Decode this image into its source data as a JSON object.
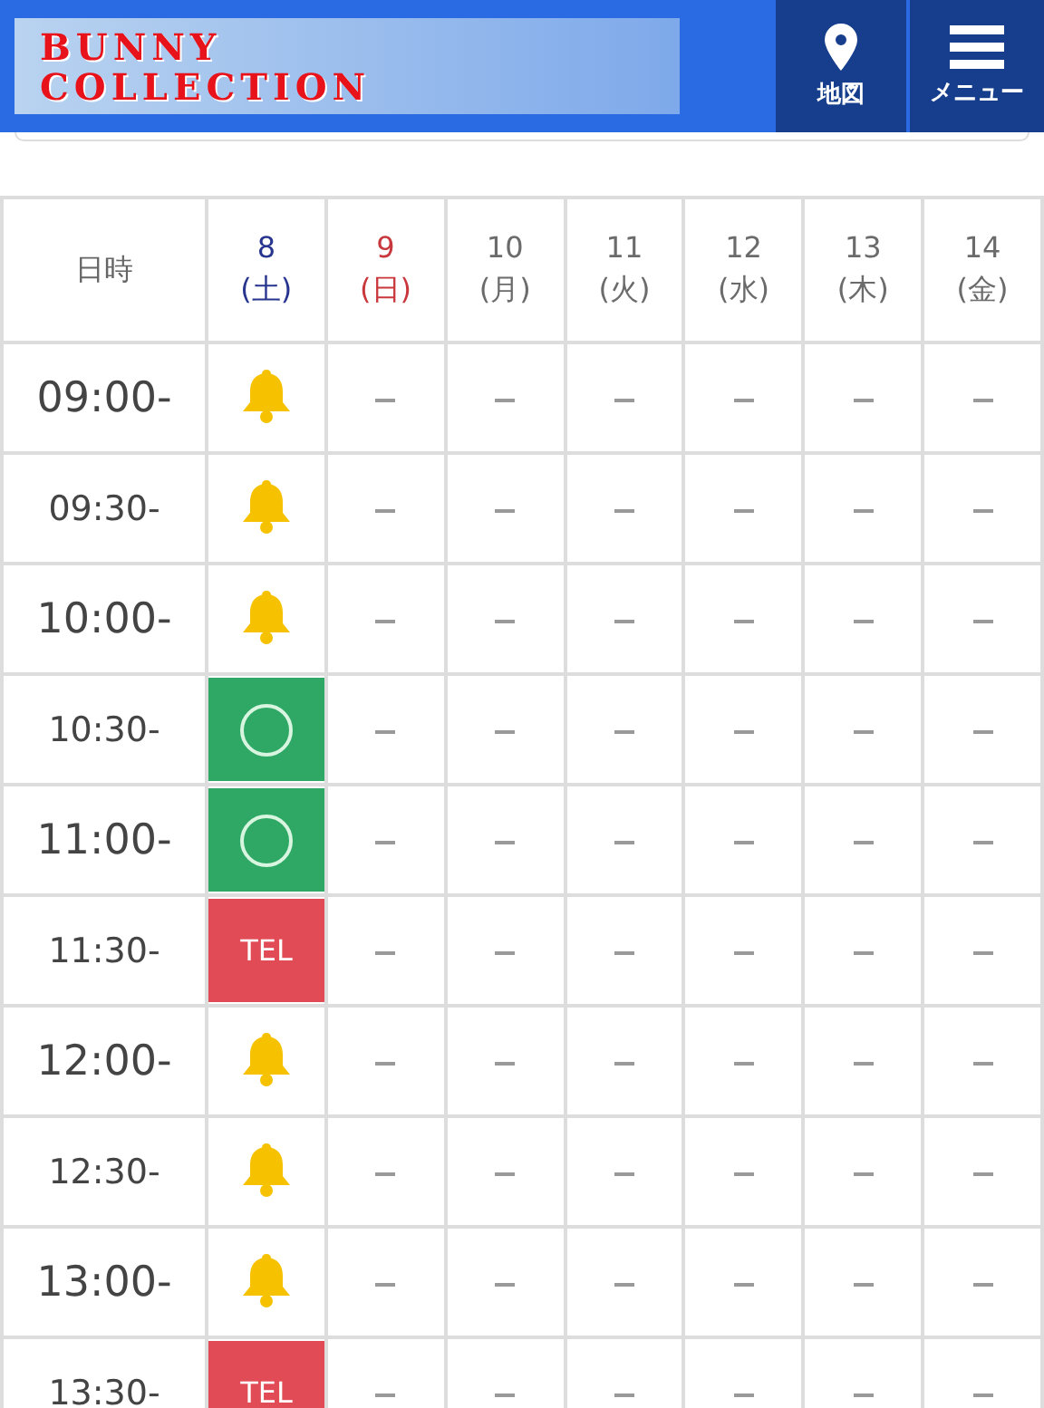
{
  "header": {
    "logo": [
      "BUNNY",
      "COLLECTION"
    ],
    "nav": [
      {
        "kind": "map",
        "label": "地図"
      },
      {
        "kind": "menu",
        "label": "メニュー"
      }
    ]
  },
  "table": {
    "corner": "日時",
    "days": [
      {
        "date": "8",
        "weekday": "(土)",
        "color": "#27358f"
      },
      {
        "date": "9",
        "weekday": "(日)",
        "color": "#c8373c"
      },
      {
        "date": "10",
        "weekday": "(月)",
        "color": "#6b6b6b"
      },
      {
        "date": "11",
        "weekday": "(火)",
        "color": "#6b6b6b"
      },
      {
        "date": "12",
        "weekday": "(水)",
        "color": "#6b6b6b"
      },
      {
        "date": "13",
        "weekday": "(木)",
        "color": "#6b6b6b"
      },
      {
        "date": "14",
        "weekday": "(金)",
        "color": "#6b6b6b"
      }
    ],
    "rows": [
      {
        "time": "09:00-",
        "major": true,
        "cells": [
          {
            "kind": "bell"
          },
          {
            "kind": "dash"
          },
          {
            "kind": "dash"
          },
          {
            "kind": "dash"
          },
          {
            "kind": "dash"
          },
          {
            "kind": "dash"
          },
          {
            "kind": "dash"
          }
        ]
      },
      {
        "time": "09:30-",
        "major": false,
        "cells": [
          {
            "kind": "bell"
          },
          {
            "kind": "dash"
          },
          {
            "kind": "dash"
          },
          {
            "kind": "dash"
          },
          {
            "kind": "dash"
          },
          {
            "kind": "dash"
          },
          {
            "kind": "dash"
          }
        ]
      },
      {
        "time": "10:00-",
        "major": true,
        "cells": [
          {
            "kind": "bell"
          },
          {
            "kind": "dash"
          },
          {
            "kind": "dash"
          },
          {
            "kind": "dash"
          },
          {
            "kind": "dash"
          },
          {
            "kind": "dash"
          },
          {
            "kind": "dash"
          }
        ]
      },
      {
        "time": "10:30-",
        "major": false,
        "cells": [
          {
            "kind": "open"
          },
          {
            "kind": "dash"
          },
          {
            "kind": "dash"
          },
          {
            "kind": "dash"
          },
          {
            "kind": "dash"
          },
          {
            "kind": "dash"
          },
          {
            "kind": "dash"
          }
        ]
      },
      {
        "time": "11:00-",
        "major": true,
        "cells": [
          {
            "kind": "open"
          },
          {
            "kind": "dash"
          },
          {
            "kind": "dash"
          },
          {
            "kind": "dash"
          },
          {
            "kind": "dash"
          },
          {
            "kind": "dash"
          },
          {
            "kind": "dash"
          }
        ]
      },
      {
        "time": "11:30-",
        "major": false,
        "cells": [
          {
            "kind": "tel",
            "label": "TEL"
          },
          {
            "kind": "dash"
          },
          {
            "kind": "dash"
          },
          {
            "kind": "dash"
          },
          {
            "kind": "dash"
          },
          {
            "kind": "dash"
          },
          {
            "kind": "dash"
          }
        ]
      },
      {
        "time": "12:00-",
        "major": true,
        "cells": [
          {
            "kind": "bell"
          },
          {
            "kind": "dash"
          },
          {
            "kind": "dash"
          },
          {
            "kind": "dash"
          },
          {
            "kind": "dash"
          },
          {
            "kind": "dash"
          },
          {
            "kind": "dash"
          }
        ]
      },
      {
        "time": "12:30-",
        "major": false,
        "cells": [
          {
            "kind": "bell"
          },
          {
            "kind": "dash"
          },
          {
            "kind": "dash"
          },
          {
            "kind": "dash"
          },
          {
            "kind": "dash"
          },
          {
            "kind": "dash"
          },
          {
            "kind": "dash"
          }
        ]
      },
      {
        "time": "13:00-",
        "major": true,
        "cells": [
          {
            "kind": "bell"
          },
          {
            "kind": "dash"
          },
          {
            "kind": "dash"
          },
          {
            "kind": "dash"
          },
          {
            "kind": "dash"
          },
          {
            "kind": "dash"
          },
          {
            "kind": "dash"
          }
        ]
      },
      {
        "time": "13:30-",
        "major": false,
        "cells": [
          {
            "kind": "tel",
            "label": "TEL"
          },
          {
            "kind": "dash"
          },
          {
            "kind": "dash"
          },
          {
            "kind": "dash"
          },
          {
            "kind": "dash"
          },
          {
            "kind": "dash"
          },
          {
            "kind": "dash"
          }
        ]
      }
    ]
  }
}
